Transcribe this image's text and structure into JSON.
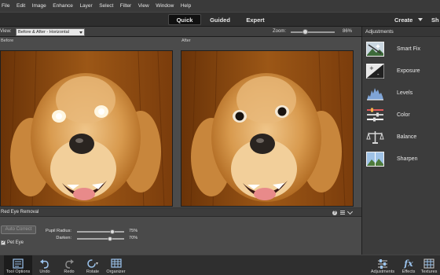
{
  "menu": {
    "items": [
      "File",
      "Edit",
      "Image",
      "Enhance",
      "Layer",
      "Select",
      "Filter",
      "View",
      "Window",
      "Help"
    ]
  },
  "modes": {
    "quick": "Quick",
    "guided": "Guided",
    "expert": "Expert",
    "create": "Create",
    "share": "Sh"
  },
  "viewbar": {
    "view_label": "View:",
    "view_value": "Before & After - Horizontal",
    "zoom_label": "Zoom:",
    "zoom_value": "86%",
    "zoom_level": 0.33
  },
  "panes": {
    "before": "Before",
    "after": "After"
  },
  "tool_options": {
    "title": "Red Eye Removal",
    "help_icon": "?",
    "auto_correct": "Auto Correct",
    "pet_eye_label": "Pet Eye",
    "pet_eye_checked": true,
    "check_mark": "✓",
    "pupil_radius_label": "Pupil Radius:",
    "pupil_radius_value": "75%",
    "pupil_radius_level": 0.75,
    "darken_label": "Darken:",
    "darken_value": "70%",
    "darken_level": 0.7
  },
  "adjustments": {
    "title": "Adjustments",
    "items": [
      {
        "label": "Smart Fix",
        "icon": "smart-fix-icon"
      },
      {
        "label": "Exposure",
        "icon": "exposure-icon"
      },
      {
        "label": "Levels",
        "icon": "levels-icon"
      },
      {
        "label": "Color",
        "icon": "color-icon"
      },
      {
        "label": "Balance",
        "icon": "balance-icon"
      },
      {
        "label": "Sharpen",
        "icon": "sharpen-icon"
      }
    ]
  },
  "taskbar": {
    "tool_options": "Tool Options",
    "undo": "Undo",
    "redo": "Redo",
    "rotate": "Rotate",
    "organizer": "Organizer",
    "adjustments": "Adjustments",
    "effects": "Effects",
    "textures": "Textures"
  },
  "colors": {
    "accent_panel": "#3c3c3c",
    "active_tab": "#101010",
    "floor_wood": "#8a4a12"
  }
}
